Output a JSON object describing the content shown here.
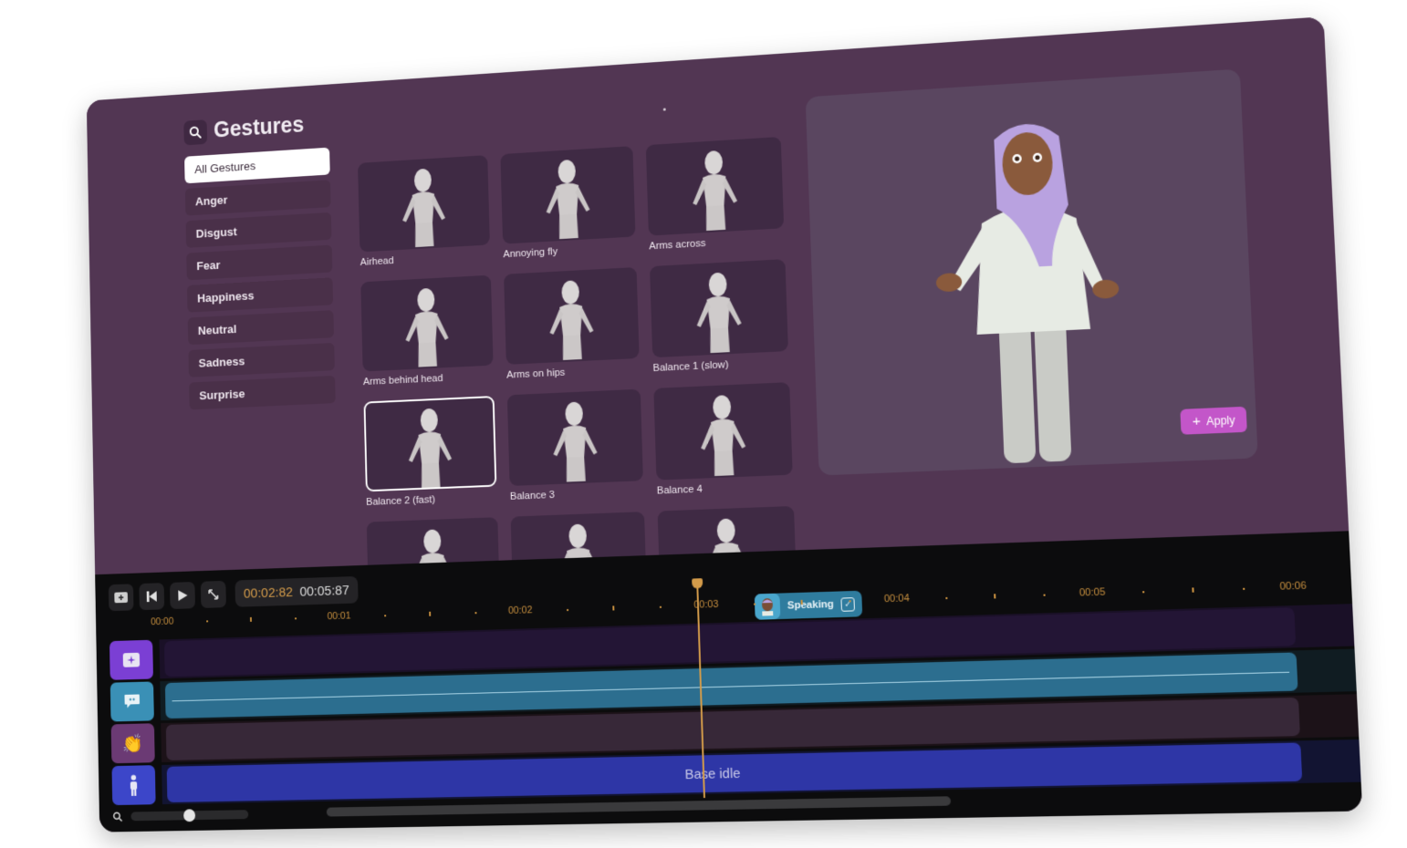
{
  "panel": {
    "title": "Gestures",
    "search_icon": "search-icon",
    "categories": [
      {
        "label": "All Gestures",
        "active": true
      },
      {
        "label": "Anger",
        "active": false
      },
      {
        "label": "Disgust",
        "active": false
      },
      {
        "label": "Fear",
        "active": false
      },
      {
        "label": "Happiness",
        "active": false
      },
      {
        "label": "Neutral",
        "active": false
      },
      {
        "label": "Sadness",
        "active": false
      },
      {
        "label": "Surprise",
        "active": false
      }
    ],
    "gestures": [
      {
        "label": "Airhead",
        "selected": false
      },
      {
        "label": "Annoying fly",
        "selected": false
      },
      {
        "label": "Arms across",
        "selected": false
      },
      {
        "label": "Arms behind head",
        "selected": false
      },
      {
        "label": "Arms on hips",
        "selected": false
      },
      {
        "label": "Balance 1 (slow)",
        "selected": false
      },
      {
        "label": "Balance 2 (fast)",
        "selected": true
      },
      {
        "label": "Balance 3",
        "selected": false
      },
      {
        "label": "Balance 4",
        "selected": false
      },
      {
        "label": "",
        "selected": false
      },
      {
        "label": "",
        "selected": false
      },
      {
        "label": "",
        "selected": false
      }
    ]
  },
  "preview": {
    "apply_label": "Apply",
    "apply_icon": "plus-icon",
    "accent": "#c356c9"
  },
  "timeline": {
    "current_time": "00:02:82",
    "total_time": "00:05:87",
    "controls": [
      "add-icon",
      "skip-back-icon",
      "play-icon",
      "expand-icon"
    ],
    "ruler_labels": [
      "00:00",
      "00:01",
      "00:02",
      "00:03",
      "00:04",
      "00:05",
      "00:06"
    ],
    "speaking_label": "Speaking",
    "speaking_checked": true,
    "tracks": [
      {
        "icon": "sparkle-icon",
        "color": "#7b3fd4",
        "clip_color": "#231535",
        "label": ""
      },
      {
        "icon": "speech-bubble-icon",
        "color": "#3a90b6",
        "clip_color": "#2c6e8f",
        "label": ""
      },
      {
        "icon": "clapping-hands-icon",
        "color": "#6b3a74",
        "clip_color": "#372838",
        "label": ""
      },
      {
        "icon": "person-icon",
        "color": "#3c46c9",
        "clip_color": "#2e36a6",
        "label": "Base idle"
      }
    ],
    "playhead_color": "#d39b4a",
    "zoom_level": 0.5
  }
}
